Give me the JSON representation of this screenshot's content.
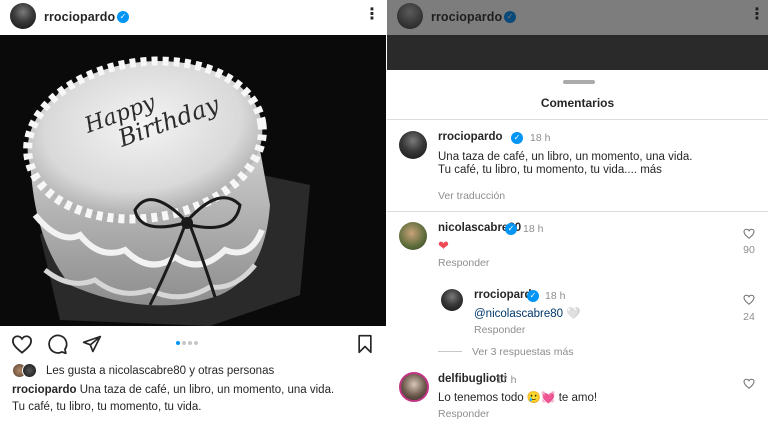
{
  "post": {
    "username": "rrociopardo",
    "more_icon": "more-vertical-icon",
    "photo": {
      "cake_text_line1": "Happy",
      "cake_text_line2": "Birthday"
    },
    "pager": {
      "count": 4,
      "active_index": 0
    },
    "likes_text": "Les gusta a nicolascabre80 y otras personas",
    "caption_user": "rrociopardo",
    "caption_line1": " Una taza de café, un libro, un momento, una vida.",
    "caption_line2": "Tu café, tu libro, tu momento, tu vida."
  },
  "sheet": {
    "title": "Comentarios",
    "main_comment": {
      "username": "rrociopardo",
      "time": "18 h",
      "line1": "Una taza de café, un libro, un momento, una vida.",
      "line2": "Tu café, tu libro, tu momento, tu vida.... más",
      "translate": "Ver traducción"
    },
    "comments": [
      {
        "username": "nicolascabre80",
        "time": "18 h",
        "text": "❤",
        "reply": "Responder",
        "likes": "90"
      },
      {
        "username": "rrociopardo",
        "time": "18 h",
        "text": "@nicolascabre80 🤍",
        "reply": "Responder",
        "likes": "24"
      },
      {
        "username": "delfibugliotti",
        "time": "17 h",
        "text": "Lo tenemos todo 🥲💓 te amo!",
        "reply": "Responder",
        "likes": ""
      }
    ],
    "view_replies": "Ver 3 respuestas más"
  },
  "colors": {
    "verified": "#0095f6",
    "heart": "#ed4956",
    "mention": "#00376b",
    "muted": "#8e8e8e"
  }
}
